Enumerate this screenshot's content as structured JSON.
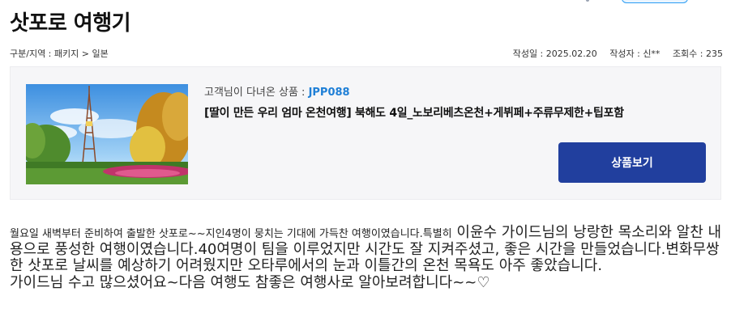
{
  "page": {
    "title": "삿포로 여행기"
  },
  "meta": {
    "category": "구분/지역 : 패키지 > 일본",
    "date_label": "작성일 :",
    "date": "2025.02.20",
    "author_label": "작성자 :",
    "author": "신**",
    "views_label": "조회수 :",
    "views": "235"
  },
  "product": {
    "visited_label": "고객님이 다녀온 상품 :",
    "code": "JPP088",
    "name": "[딸이 만든 우리 엄마 온천여행] 북해도 4일_노보리베츠온천+게뷔페+주류무제한+팁포함",
    "view_button": "상품보기",
    "image_icon": "sapporo-tv-tower-photo"
  },
  "review": {
    "part1_small": "월요일 새벽부터 준비하여 출발한 삿포로~~지인4명이 뭉치는 기대에 가득찬 여행이였습니다.특별히",
    "part1_large": " 이윤수 가이드님의 낭랑한 목소리와 알찬 내용으로 풍성한 여행이였습니다.40여명이 팀을 이루었지만 시간도 잘 지켜주셨고, 좋은 시간을 만들었습니다.변화무쌍한 삿포로 날씨를 예상하기 어려웠지만 오타루에서의 눈과 이틀간의 온천 목욕도 아주 좋았습니다.",
    "part2": "가이드님 수고 많으셨어요~다음 여행도 참좋은 여행사로 알아보려합니다~~♡"
  },
  "colors": {
    "accent_button": "#213f9e",
    "code_blue": "#1f7fd6",
    "box_bg": "#f6f6f8"
  }
}
